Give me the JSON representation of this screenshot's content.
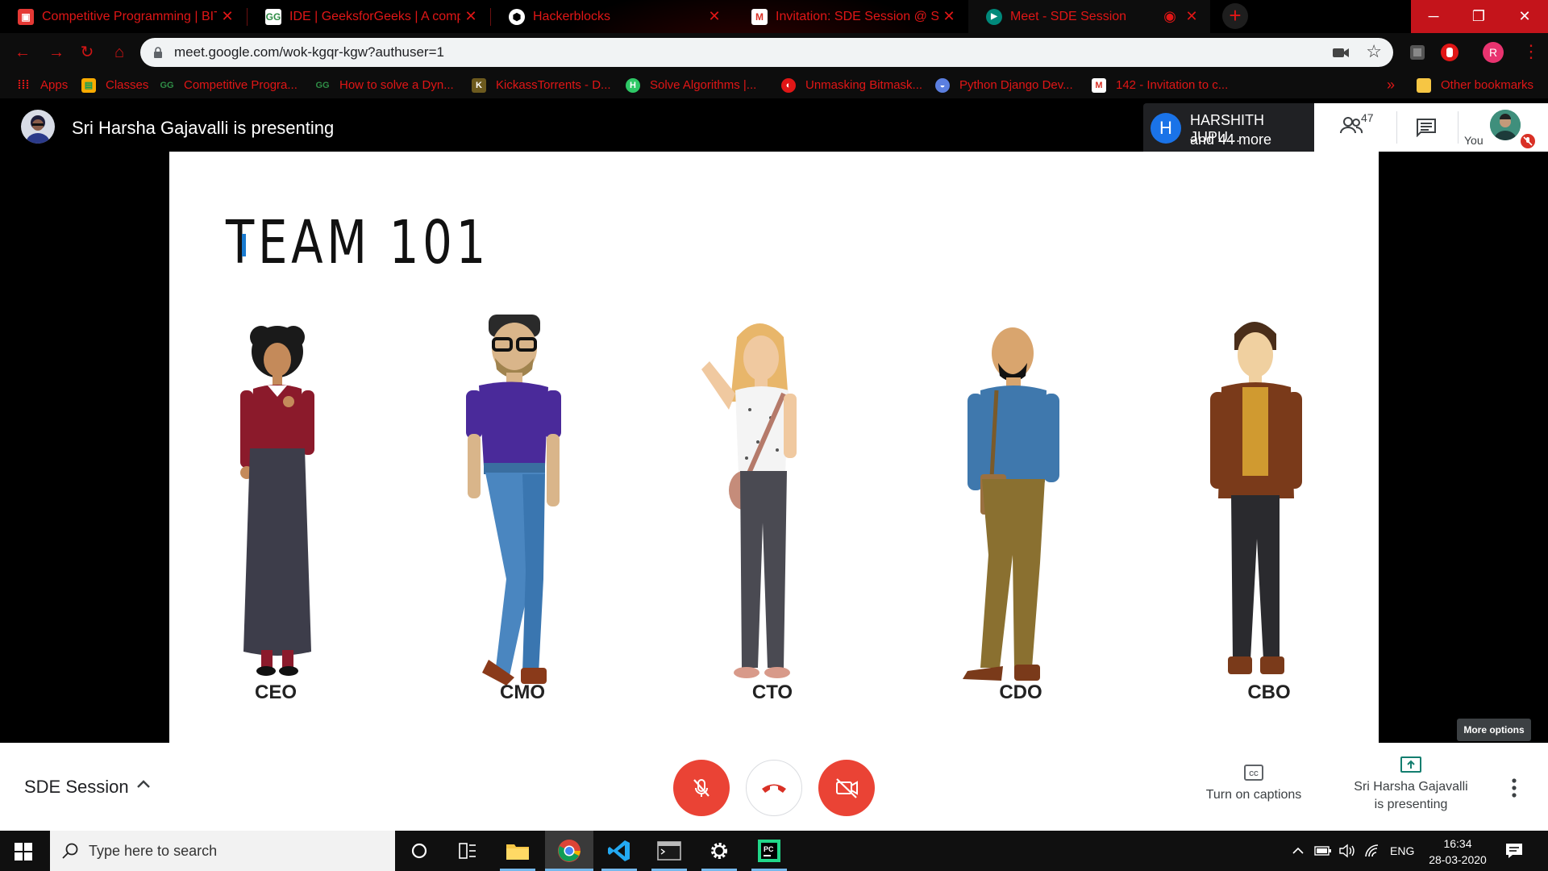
{
  "browser": {
    "tabs": [
      {
        "title": "Competitive Programming | BIT C",
        "favicon": "bit-icon",
        "active": false
      },
      {
        "title": "IDE | GeeksforGeeks | A compute",
        "favicon": "gfg-icon",
        "active": false
      },
      {
        "title": "Hackerblocks",
        "favicon": "hackerblocks-icon",
        "active": false
      },
      {
        "title": "Invitation: SDE Session @ Sat M",
        "favicon": "gmail-icon",
        "active": false
      },
      {
        "title": "Meet - SDE Session",
        "favicon": "meet-icon",
        "active": true
      }
    ],
    "url": "meet.google.com/wok-kgqr-kgw?authuser=1",
    "profile_initial": "R",
    "bookmarks": [
      {
        "label": "Apps",
        "icon": "apps-grid-icon"
      },
      {
        "label": "Classes",
        "icon": "classroom-icon"
      },
      {
        "label": "Competitive Progra...",
        "icon": "gfg-icon"
      },
      {
        "label": "How to solve a Dyn...",
        "icon": "gfg-icon"
      },
      {
        "label": "KickassTorrents - D...",
        "icon": "kickass-icon"
      },
      {
        "label": "Solve Algorithms |...",
        "icon": "hackerrank-icon"
      },
      {
        "label": "Unmasking Bitmask...",
        "icon": "hackerearth-icon"
      },
      {
        "label": "Python Django Dev...",
        "icon": "udemy-icon"
      },
      {
        "label": "142 - Invitation to c...",
        "icon": "gmail-icon"
      }
    ],
    "other_bookmarks": "Other bookmarks"
  },
  "meet": {
    "presenting_banner": "Sri Harsha Gajavalli is presenting",
    "participants_card": {
      "initial": "H",
      "line1": "HARSHITH JUPU...",
      "line2": "and 44 more"
    },
    "participant_count": "47",
    "you_label": "You",
    "more_options_tooltip": "More options",
    "meeting_name": "SDE Session",
    "captions_label": "Turn on captions",
    "presenting_line1": "Sri Harsha Gajavalli",
    "presenting_line2": "is presenting"
  },
  "slide": {
    "title": "TEAM 101",
    "roles": [
      "CEO",
      "CMO",
      "CTO",
      "CDO",
      "CBO"
    ]
  },
  "taskbar": {
    "search_placeholder": "Type here to search",
    "language": "ENG",
    "time": "16:34",
    "date": "28-03-2020"
  },
  "colors": {
    "chrome_theme_red": "#e01616",
    "meet_red": "#ea4335",
    "meet_blue": "#1a73e8"
  }
}
